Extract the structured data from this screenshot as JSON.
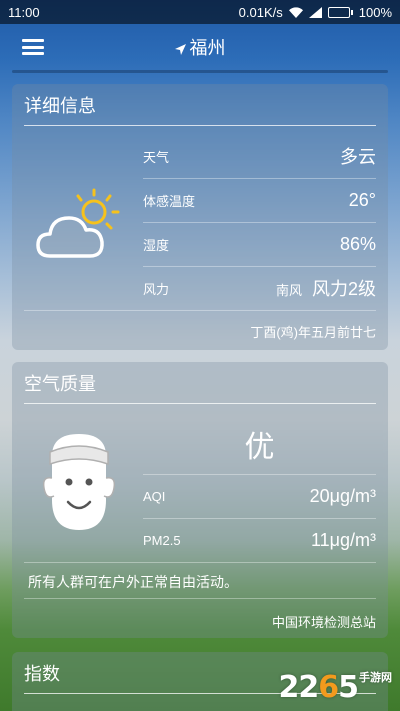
{
  "status_bar": {
    "time": "11:00",
    "network_speed": "0.01K/s",
    "battery_percent": "100%",
    "battery_level": 1.0,
    "icons": [
      "wifi-icon",
      "signal-icon",
      "battery-icon"
    ]
  },
  "header": {
    "city": "福州",
    "menu_icon": "hamburger-menu-icon",
    "location_icon": "location-arrow-icon"
  },
  "details": {
    "title": "详细信息",
    "weather_icon": "partly-cloudy-icon",
    "rows": [
      {
        "label": "天气",
        "value": "多云"
      },
      {
        "label": "体感温度",
        "value": "26°"
      },
      {
        "label": "湿度",
        "value": "86%"
      },
      {
        "label": "风力",
        "direction": "南风",
        "value": "风力2级"
      }
    ],
    "lunar_date": "丁酉(鸡)年五月前廿七"
  },
  "air_quality": {
    "title": "空气质量",
    "face_icon": "smiling-face-icon",
    "level": "优",
    "rows": [
      {
        "label": "AQI",
        "value": "20μg/m³"
      },
      {
        "label": "PM2.5",
        "value": "11μg/m³"
      }
    ],
    "advice": "所有人群可在户外正常自由活动。",
    "source": "中国环境检测总站"
  },
  "index": {
    "title": "指数"
  },
  "watermark": {
    "part1": "22",
    "part2": "6",
    "part3": "5",
    "sub": "手游网"
  },
  "colors": {
    "accent_orange": "#f39a1d",
    "sun_yellow": "#f6c21c",
    "text": "#ffffff"
  }
}
